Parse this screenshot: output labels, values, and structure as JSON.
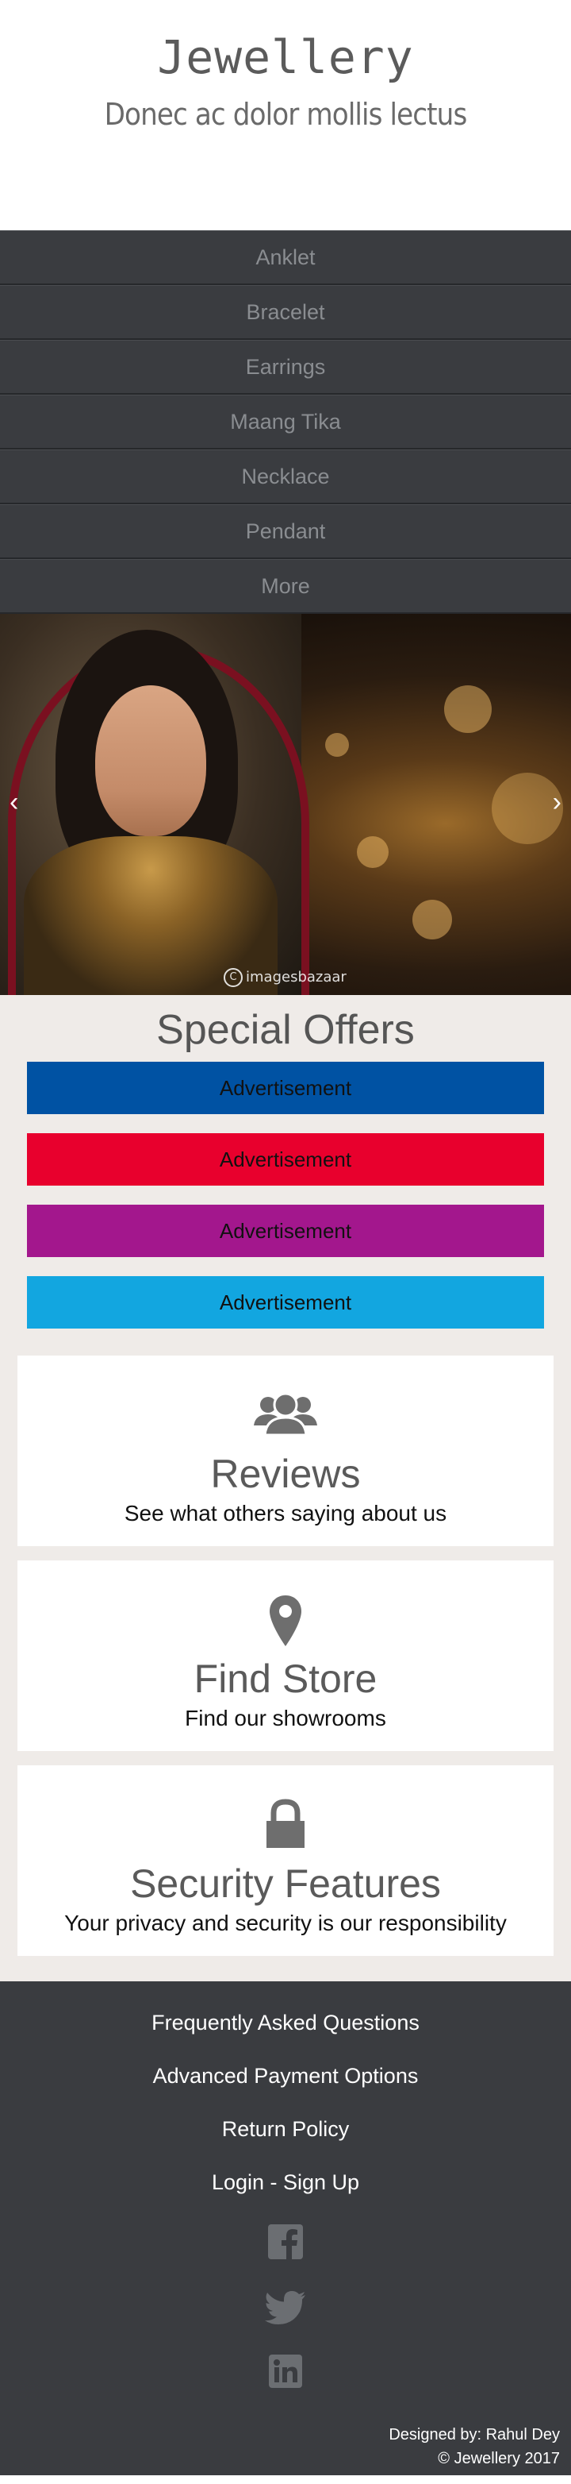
{
  "header": {
    "brand": "Jewellery",
    "tagline": "Donec ac dolor mollis lectus"
  },
  "nav": {
    "items": [
      "Anklet",
      "Bracelet",
      "Earrings",
      "Maang Tika",
      "Necklace",
      "Pendant",
      "More"
    ]
  },
  "carousel": {
    "prev_icon": "‹",
    "next_icon": "›",
    "watermark": "imagesbazaar",
    "watermark_symbol": "C"
  },
  "offers": {
    "title": "Special Offers",
    "ads": [
      {
        "label": "Advertisement",
        "color": "#0052a3"
      },
      {
        "label": "Advertisement",
        "color": "#e8002d"
      },
      {
        "label": "Advertisement",
        "color": "#a3178d"
      },
      {
        "label": "Advertisement",
        "color": "#12a6e0"
      }
    ]
  },
  "features": [
    {
      "icon": "users-icon",
      "title": "Reviews",
      "desc": "See what others saying about us"
    },
    {
      "icon": "map-marker-icon",
      "title": "Find Store",
      "desc": "Find our showrooms"
    },
    {
      "icon": "lock-icon",
      "title": "Security Features",
      "desc": "Your privacy and security is our responsibility"
    }
  ],
  "footer": {
    "links": [
      "Frequently Asked Questions",
      "Advanced Payment Options",
      "Return Policy",
      "Login - Sign Up"
    ],
    "social": [
      "facebook-icon",
      "twitter-icon",
      "linkedin-icon"
    ],
    "designed_by": "Designed by: Rahul Dey",
    "copyright": "© Jewellery 2017"
  },
  "colors": {
    "nav_bg": "#3a3c40",
    "nav_text": "#8a8d91",
    "offers_bg": "#efebe8",
    "icon_gray": "#6e6e6e"
  }
}
